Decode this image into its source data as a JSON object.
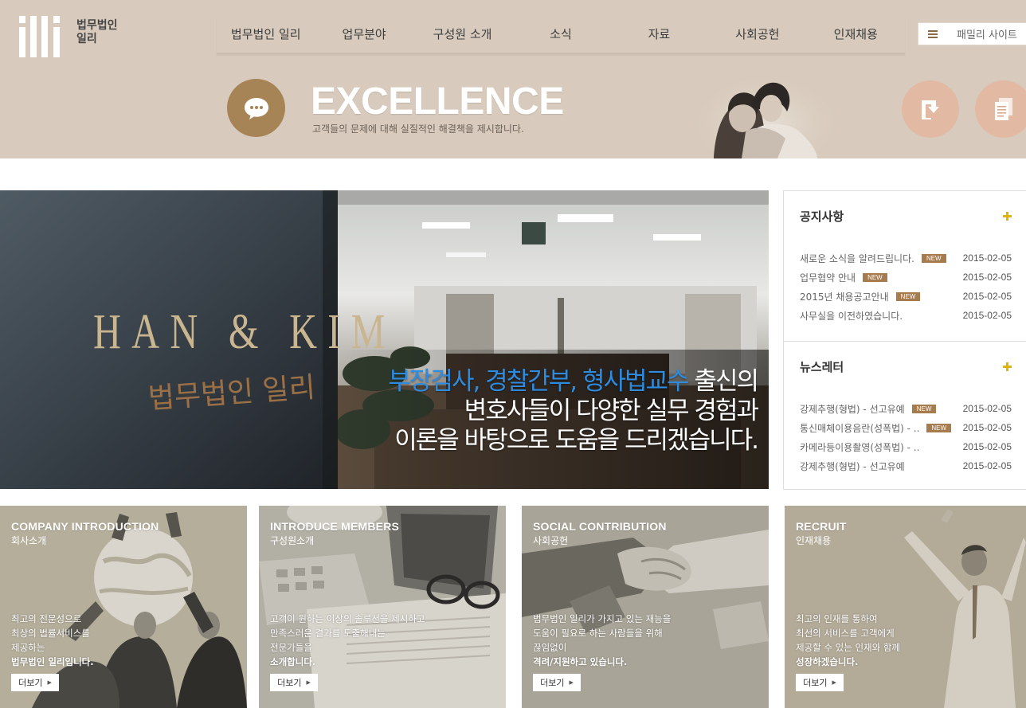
{
  "header": {
    "logo_text": "법무법인\n일리",
    "nav": [
      "법무법인 일리",
      "업무분야",
      "구성원 소개",
      "소식",
      "자료",
      "사회공헌",
      "인재채용"
    ],
    "family_site_label": "패밀리 사이트"
  },
  "banner": {
    "title": "EXCELLENCE",
    "subtitle": "고객들의 문제에 대해 실질적인 해결책을 제시합니다."
  },
  "hero": {
    "sign_line1": "HAN & KIM",
    "sign_line2": "법무법인 일리",
    "highlight": "부장검사, 경찰간부, 형사법교수",
    "line1_rest": " 출신의",
    "line2": "변호사들이 다양한 실무 경험과",
    "line3": "이론을 바탕으로 도움을 드리겠습니다."
  },
  "notice": {
    "title": "공지사항",
    "items": [
      {
        "text": "새로운 소식을 알려드립니다.",
        "is_new": true,
        "badge": "NEW",
        "date": "2015-02-05"
      },
      {
        "text": "업무협약 안내",
        "is_new": true,
        "badge": "NEW",
        "date": "2015-02-05"
      },
      {
        "text": "2015년 채용공고안내",
        "is_new": true,
        "badge": "NEW",
        "date": "2015-02-05"
      },
      {
        "text": "사무실을 이전하였습니다.",
        "is_new": false,
        "badge": "",
        "date": "2015-02-05"
      }
    ]
  },
  "newsletter": {
    "title": "뉴스레터",
    "items": [
      {
        "text": "강제추행(형법) - 선고유예",
        "is_new": true,
        "badge": "NEW",
        "date": "2015-02-05"
      },
      {
        "text": "통신매체이용음란(성폭법) - ..",
        "is_new": true,
        "badge": "NEW",
        "date": "2015-02-05"
      },
      {
        "text": "카메라등이용촬영(성폭법) - ..",
        "is_new": false,
        "badge": "",
        "date": "2015-02-05"
      },
      {
        "text": "강제추행(형법) - 선고유예",
        "is_new": false,
        "badge": "",
        "date": "2015-02-05"
      }
    ]
  },
  "cards": [
    {
      "en": "COMPANY INTRODUCTION",
      "ko": "회사소개",
      "desc": [
        "최고의 전문성으로",
        "최상의 법률서비스를",
        "제공하는"
      ],
      "desc_bold": "법무법인 일리입니다.",
      "more": "더보기"
    },
    {
      "en": "INTRODUCE MEMBERS",
      "ko": "구성원소개",
      "desc": [
        "고객이 원하는 이상의 솔루션을 제시하고",
        "만족스러운 결과를 도출해내는",
        "전문가들을"
      ],
      "desc_bold": "소개합니다.",
      "more": "더보기"
    },
    {
      "en": "SOCIAL CONTRIBUTION",
      "ko": "사회공헌",
      "desc": [
        "법무법인 일리가 가지고 있는 재능을",
        "도움이 필요로 하는 사람들을 위해",
        "끊임없이"
      ],
      "desc_bold": "격려/지원하고 있습니다.",
      "more": "더보기"
    },
    {
      "en": "RECRUIT",
      "ko": "인재채용",
      "desc": [
        "최고의 인재를 통하여",
        "최선의 서비스를 고객에게",
        "제공할 수 있는 인재와 함께"
      ],
      "desc_bold": "성장하겠습니다.",
      "more": "더보기"
    }
  ],
  "colors": {
    "band": "#d8cbbd",
    "accent_brown": "#a78455",
    "highlight_blue": "#2d8be0",
    "new_badge": "#a67c4f",
    "plus_yellow": "#e2b400"
  },
  "icons": [
    "logo-mark",
    "speech-bubble-icon",
    "menu-icon",
    "download-document-icon",
    "documents-icon",
    "plus-icon",
    "arrow-right-icon"
  ]
}
